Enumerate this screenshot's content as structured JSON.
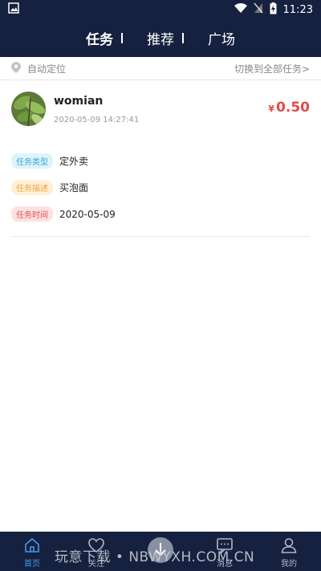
{
  "statusbar": {
    "time": "11:23"
  },
  "topnav": {
    "tabs": [
      {
        "label": "任务"
      },
      {
        "label": "推荐"
      },
      {
        "label": "广场"
      }
    ]
  },
  "location": {
    "left_text": "自动定位",
    "right_text": "切换到全部任务>"
  },
  "task": {
    "user_name": "womian",
    "timestamp": "2020-05-09 14:27:41",
    "price_currency": "¥",
    "price_value": "0.50",
    "type_tag": "任务类型",
    "type_value": "定外卖",
    "desc_tag": "任务描述",
    "desc_value": "买泡面",
    "time_tag": "任务时间",
    "time_value": "2020-05-09"
  },
  "bottomnav": {
    "items": [
      {
        "label": "首页",
        "icon": "home-icon"
      },
      {
        "label": "关注",
        "icon": "heart-icon"
      },
      {
        "label": "",
        "icon": "center-action-icon"
      },
      {
        "label": "消息",
        "icon": "message-icon"
      },
      {
        "label": "我的",
        "icon": "user-icon"
      }
    ]
  },
  "watermark": {
    "text": "玩意下载 • NBWYXH.COM.CN"
  },
  "colors": {
    "header_bg": "#16213f",
    "price": "#e24b4b",
    "active_nav": "#3b9cf0"
  }
}
